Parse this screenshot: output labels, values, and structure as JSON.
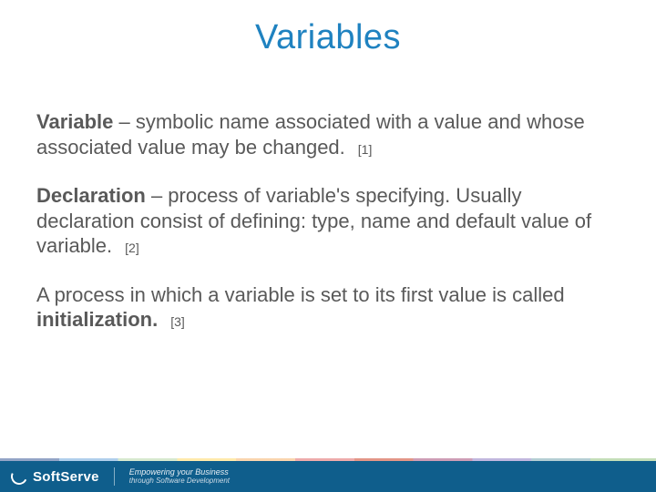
{
  "title": "Variables",
  "paragraphs": [
    {
      "term": "Variable",
      "sep": " – ",
      "text": "symbolic name associated with a value and whose associated value may be changed.",
      "ref": "[1]",
      "bold_tail": ""
    },
    {
      "term": "Declaration",
      "sep": " – ",
      "text": "process of variable's specifying. Usually declaration consist of defining: type, name and default value of variable.",
      "ref": "[2]",
      "bold_tail": ""
    },
    {
      "term": "",
      "sep": "",
      "text": "A process in which a variable is set to its first value is called ",
      "ref": "[3]",
      "bold_tail": "initialization."
    }
  ],
  "footer": {
    "brand": "SoftServe",
    "tagline_top": "Empowering your Business",
    "tagline_bot": "through Software Development"
  }
}
